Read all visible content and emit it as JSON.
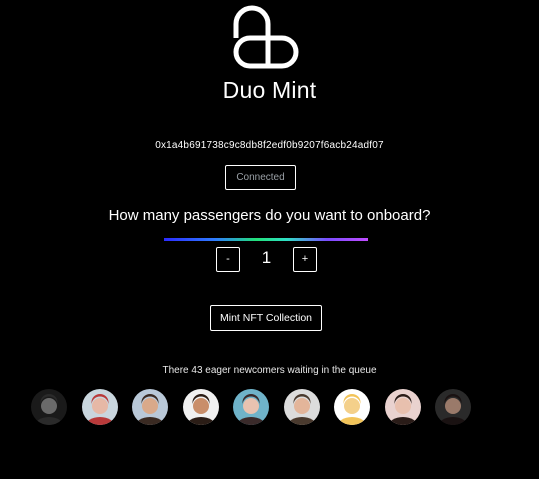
{
  "brand": {
    "name": "Duo Mint",
    "logo_icon": "duo-mint-logo-icon"
  },
  "wallet": {
    "address": "0x1a4b691738c9c8db8f2edf0b9207f6acb24adf07",
    "status_label": "Connected"
  },
  "mint": {
    "question": "How many passengers do you want to onboard?",
    "decrement_label": "-",
    "increment_label": "+",
    "quantity": "1",
    "mint_label": "Mint NFT Collection"
  },
  "queue": {
    "text": "There 43 eager newcomers waiting in the queue",
    "avatars": [
      {
        "name": "avatar-1",
        "bg": "#1a1a1a",
        "skin": "#6a6a6a",
        "hair": "#2a2a2a"
      },
      {
        "name": "avatar-2",
        "bg": "#c9d6de",
        "skin": "#e6b8a6",
        "hair": "#b93a3a"
      },
      {
        "name": "avatar-3",
        "bg": "#b9c8d8",
        "skin": "#d9a98a",
        "hair": "#3a2a22"
      },
      {
        "name": "avatar-4",
        "bg": "#f1f1f1",
        "skin": "#c98e6a",
        "hair": "#2b1d16"
      },
      {
        "name": "avatar-5",
        "bg": "#6fb3c9",
        "skin": "#e8c2b0",
        "hair": "#3a2a2a"
      },
      {
        "name": "avatar-6",
        "bg": "#dcdcdc",
        "skin": "#e3b59a",
        "hair": "#4a3a2e"
      },
      {
        "name": "avatar-7",
        "bg": "#ffffff",
        "skin": "#f4d08a",
        "hair": "#f2c45a"
      },
      {
        "name": "avatar-8",
        "bg": "#e9d2cf",
        "skin": "#e8c0ae",
        "hair": "#2a1c18"
      },
      {
        "name": "avatar-9",
        "bg": "#2a2a2a",
        "skin": "#9a7a6a",
        "hair": "#1a1212"
      }
    ]
  },
  "colors": {
    "background": "#000000",
    "text": "#ffffff",
    "muted": "#9aa0a6",
    "gradient": [
      "#2c2cff",
      "#2f7dff",
      "#22e07a",
      "#2ee0c4",
      "#7a4cff",
      "#c04cff"
    ]
  }
}
